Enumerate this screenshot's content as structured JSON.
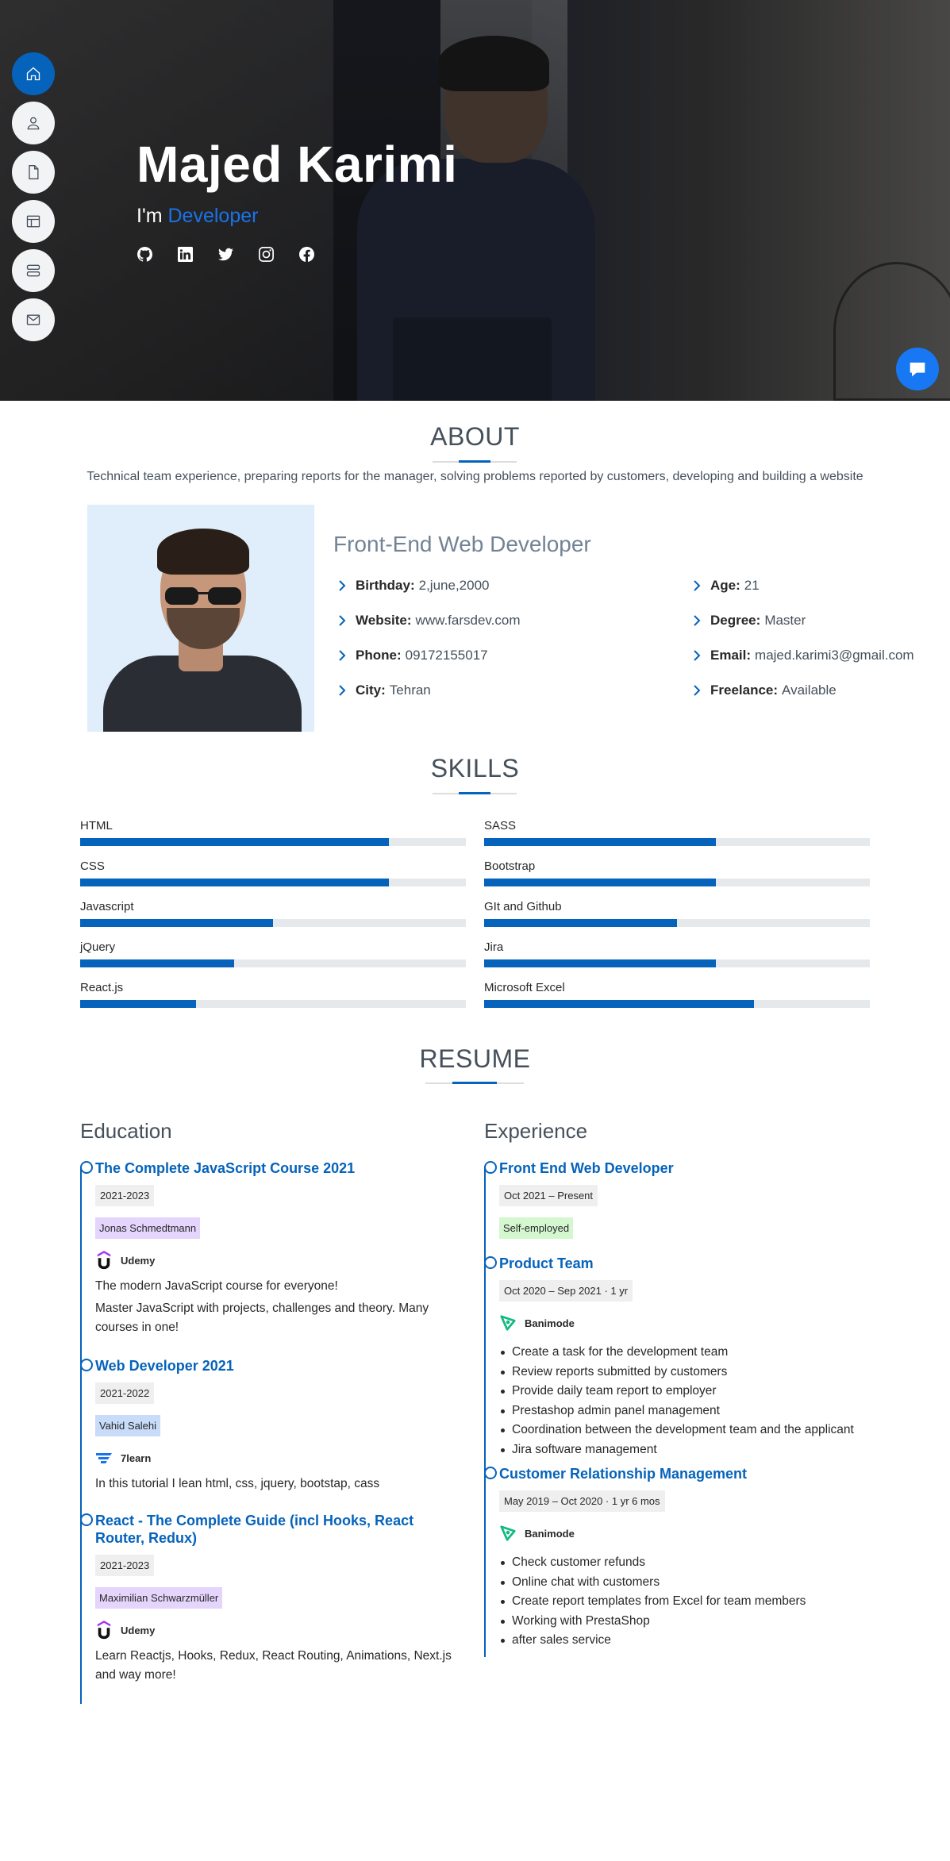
{
  "hero": {
    "name": "Majed Karimi",
    "prefix": "I'm",
    "typed": "Developer",
    "socials": [
      "github-icon",
      "linkedin-icon",
      "twitter-icon",
      "instagram-icon",
      "facebook-icon"
    ]
  },
  "nav": [
    "home-icon",
    "person-icon",
    "file-icon",
    "portfolio-icon",
    "server-icon",
    "envelope-icon"
  ],
  "colors": {
    "accent": "#0563bb",
    "chat": "#1877f2"
  },
  "about": {
    "title": "ABOUT",
    "description": "Technical team experience, preparing reports for the manager, solving problems reported by customers, developing and building a website",
    "role": "Front-End Web Developer",
    "left": [
      {
        "label": "Birthday:",
        "value": "2,june,2000"
      },
      {
        "label": "Website:",
        "value": "www.farsdev.com"
      },
      {
        "label": "Phone:",
        "value": "09172155017"
      },
      {
        "label": "City:",
        "value": "Tehran"
      }
    ],
    "right": [
      {
        "label": "Age:",
        "value": "21"
      },
      {
        "label": "Degree:",
        "value": "Master"
      },
      {
        "label": "Email:",
        "value": "majed.karimi3@gmail.com"
      },
      {
        "label": "Freelance:",
        "value": "Available"
      }
    ]
  },
  "skills": {
    "title": "SKILLS",
    "left": [
      {
        "name": "HTML",
        "percent": 80
      },
      {
        "name": "CSS",
        "percent": 80
      },
      {
        "name": "Javascript",
        "percent": 50
      },
      {
        "name": "jQuery",
        "percent": 40
      },
      {
        "name": "React.js",
        "percent": 30
      }
    ],
    "right": [
      {
        "name": "SASS",
        "percent": 60
      },
      {
        "name": "Bootstrap",
        "percent": 60
      },
      {
        "name": "GIt and Github",
        "percent": 50
      },
      {
        "name": "Jira",
        "percent": 60
      },
      {
        "name": "Microsoft Excel",
        "percent": 70
      }
    ]
  },
  "resume": {
    "title": "RESUME",
    "education_title": "Education",
    "experience_title": "Experience",
    "education": [
      {
        "title": "The Complete JavaScript Course 2021",
        "date": "2021-2023",
        "tag": "Jonas Schmedtmann",
        "org": "Udemy",
        "desc": [
          "The modern JavaScript course for everyone!",
          "Master JavaScript with projects, challenges and theory. Many courses in one!"
        ]
      },
      {
        "title": "Web Developer 2021",
        "date": "2021-2022",
        "tag": "Vahid Salehi",
        "org": "7learn",
        "desc": [
          "In this tutorial I lean html, css, jquery, bootstap, cass"
        ]
      },
      {
        "title": "React - The Complete Guide (incl Hooks, React Router, Redux)",
        "date": "2021-2023",
        "tag": "Maximilian Schwarzmüller",
        "org": "Udemy",
        "desc": [
          "Learn Reactjs, Hooks, Redux, React Routing, Animations, Next.js and way more!"
        ]
      }
    ],
    "experience": [
      {
        "title": "Front End Web Developer",
        "date": "Oct 2021 – Present",
        "tag": "Self-employed"
      },
      {
        "title": "Product Team",
        "date": "Oct 2020 – Sep 2021 · 1 yr",
        "org": "Banimode",
        "bullets": [
          "Create a task for the development team",
          "Review reports submitted by customers",
          "Provide daily team report to employer",
          "Prestashop admin panel management",
          "Coordination between the development team and the applicant",
          "Jira software management"
        ]
      },
      {
        "title": "Customer Relationship Management",
        "date": "May 2019 – Oct 2020 · 1 yr 6 mos",
        "org": "Banimode",
        "bullets": [
          "Check customer refunds",
          "Online chat with customers",
          "Create report templates from Excel for team members",
          "Working with PrestaShop",
          "after sales service"
        ]
      }
    ]
  }
}
